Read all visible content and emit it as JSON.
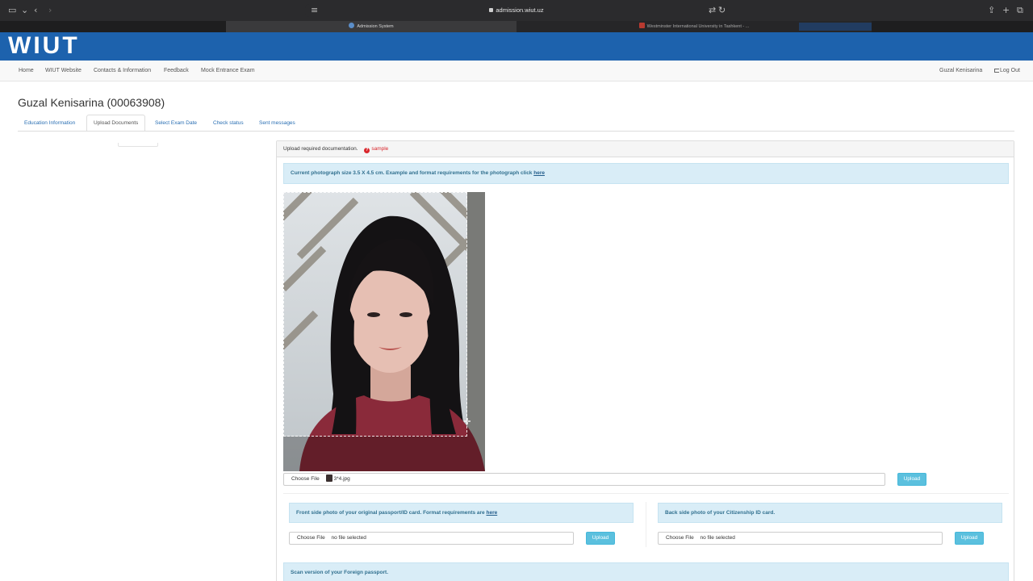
{
  "browser": {
    "address": "admission.wiut.uz",
    "tabs": [
      {
        "label": "Admission System"
      },
      {
        "label": "Westminster International University in Tashkent - ..."
      }
    ]
  },
  "header": {
    "brand": "WIUT"
  },
  "nav": {
    "items": [
      "Home",
      "WIUT Website",
      "Contacts & Information",
      "Feedback",
      "Mock Entrance Exam"
    ],
    "user": "Guzal Kenisarina",
    "logout": "Log Out"
  },
  "page": {
    "title": "Guzal Kenisarina (00063908)",
    "tabs": [
      "Education Information",
      "Upload Documents",
      "Select Exam Date",
      "Check status",
      "Sent messages"
    ],
    "active_tab": "Upload Documents"
  },
  "panel": {
    "heading": "Upload required documentation.",
    "sample_label": "sample",
    "photo_notice": "Current photograph size 3.5 X 4.5 cm. Example and format requirements for the photograph click ",
    "photo_notice_link": "here",
    "photo_file": {
      "choose_label": "Choose File",
      "file_name": "3*4.jpg",
      "upload_label": "Upload"
    },
    "passport_front": {
      "notice": "Front side photo of your original passport/ID card. Format requirements are ",
      "notice_link": "here",
      "choose_label": "Choose File",
      "file_name": "no file selected",
      "upload_label": "Upload"
    },
    "id_back": {
      "notice": "Back side photo of your Citizenship ID card.",
      "choose_label": "Choose File",
      "file_name": "no file selected",
      "upload_label": "Upload"
    },
    "foreign_passport": {
      "notice": "Scan version of your Foreign passport."
    }
  },
  "colors": {
    "brand_blue": "#1d62ad",
    "info_bg": "#d9edf7",
    "upload_btn": "#5bc0de",
    "sample_red": "#d9262c"
  }
}
